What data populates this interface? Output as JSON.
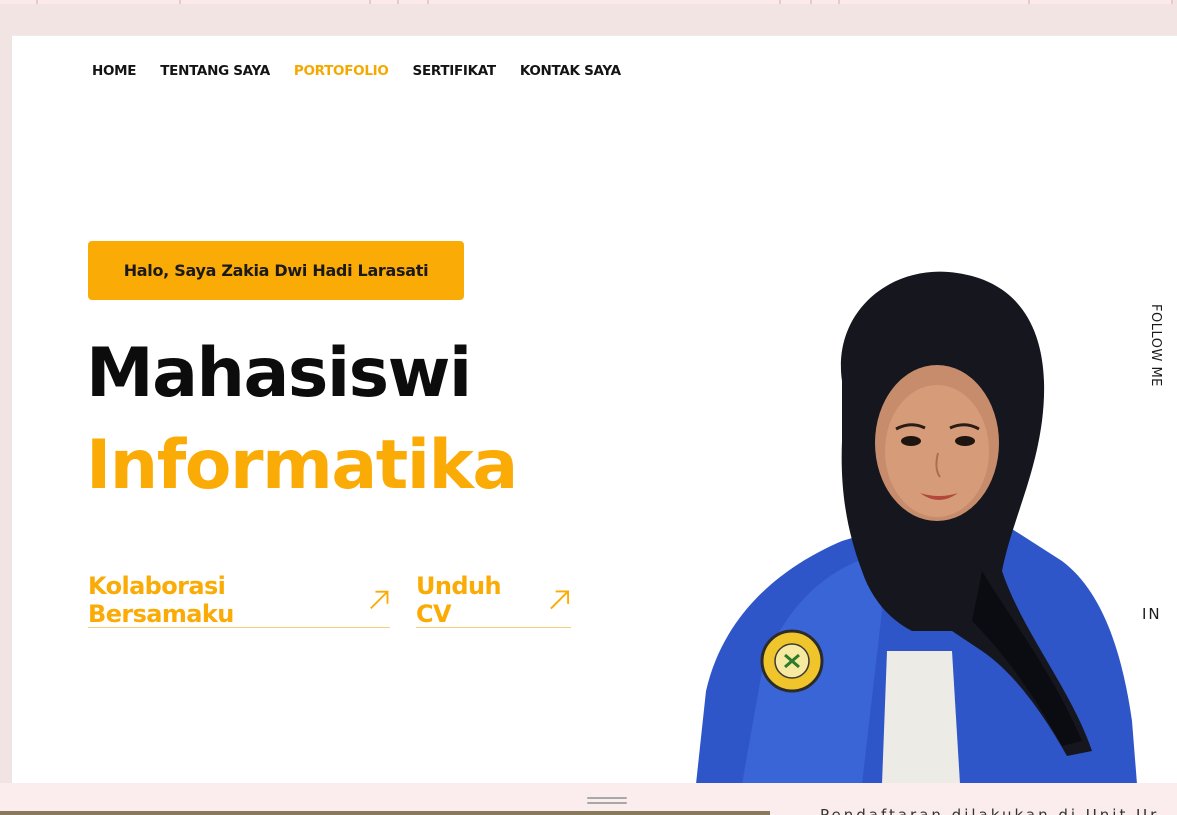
{
  "nav": {
    "items": [
      {
        "label": "HOME",
        "active": false
      },
      {
        "label": "TENTANG SAYA",
        "active": false
      },
      {
        "label": "PORTOFOLIO",
        "active": true
      },
      {
        "label": "SERTIFIKAT",
        "active": false
      },
      {
        "label": "KONTAK SAYA",
        "active": false
      }
    ]
  },
  "hero": {
    "greeting": "Halo, Saya Zakia Dwi Hadi Larasati",
    "title_line1": "Mahasiswi",
    "title_line2": "Informatika",
    "cta_primary": "Kolaborasi Bersamaku",
    "cta_secondary": "Unduh CV"
  },
  "social": {
    "heading": "FOLLOW ME",
    "linkedin": "IN"
  },
  "footer": {
    "snippet": "Pendaftaran dilakukan di Unit Ur"
  },
  "colors": {
    "accent": "#fbab05",
    "text": "#0c0c0c",
    "background": "#ffffff",
    "page_bg": "#f3e4e4"
  }
}
